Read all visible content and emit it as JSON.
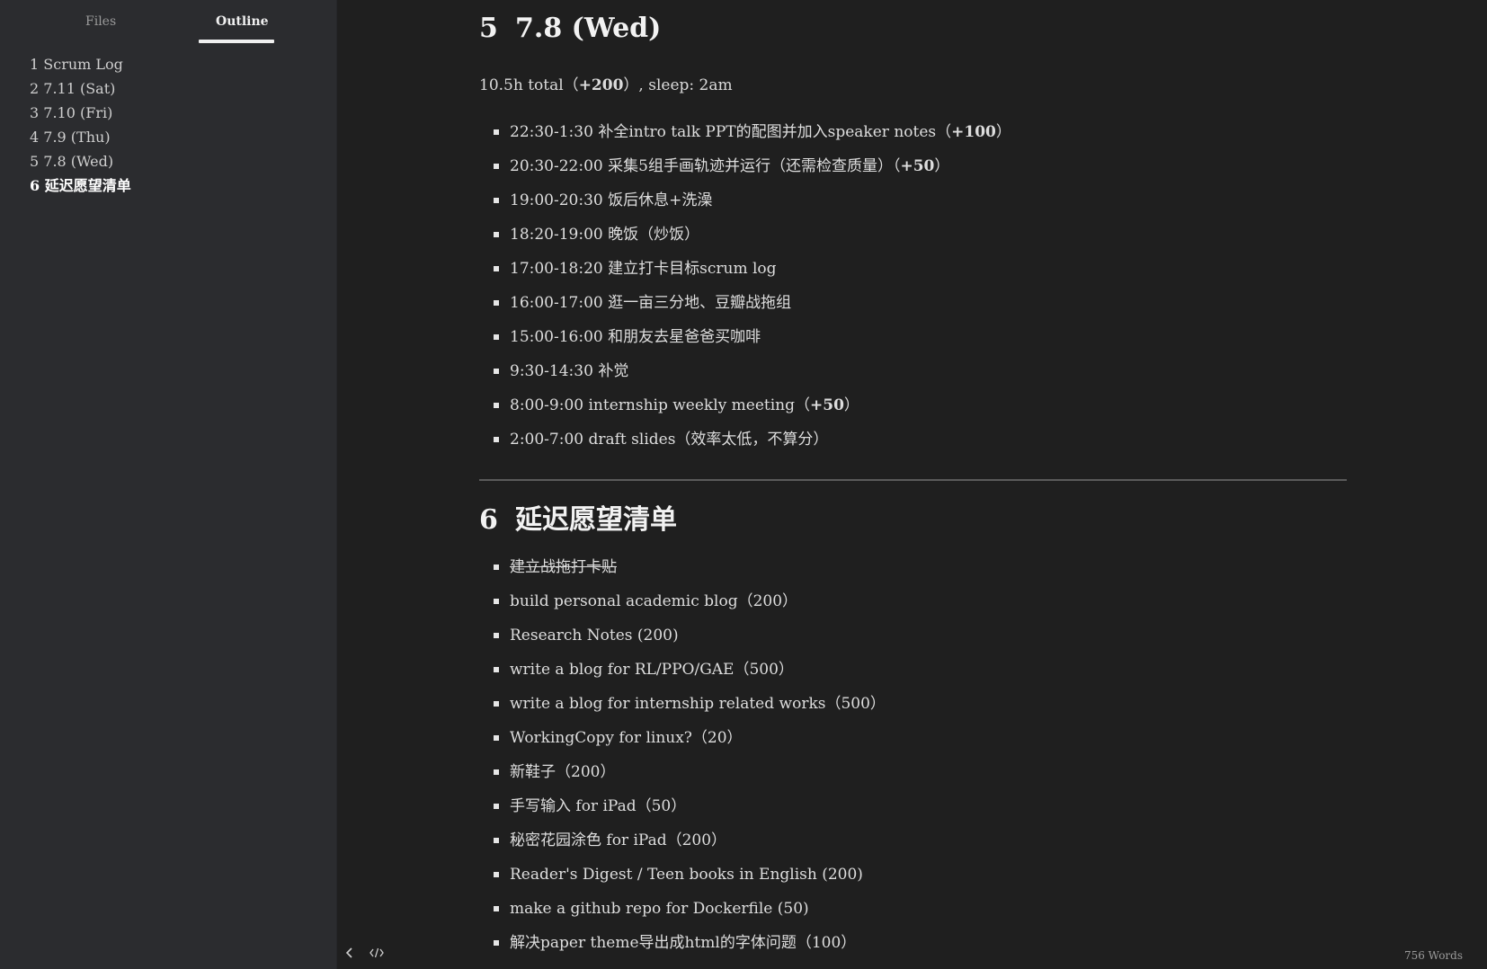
{
  "sidebar": {
    "tabs": {
      "files": "Files",
      "outline": "Outline"
    },
    "outline": [
      "1 Scrum Log",
      "2 7.11 (Sat)",
      "3 7.10 (Fri)",
      "4 7.9 (Thu)",
      "5 7.8 (Wed)",
      "6 延迟愿望清单"
    ]
  },
  "section5": {
    "num": "5",
    "title": "7.8 (Wed)",
    "summary_pre": "10.5h total（",
    "summary_bold": "+200",
    "summary_post": "）, sleep: 2am",
    "items": [
      {
        "pre": "22:30-1:30 补全intro talk PPT的配图并加入speaker notes（",
        "bold": "+100",
        "post": "）"
      },
      {
        "pre": "20:30-22:00 采集5组手画轨迹并运行（还需检查质量）（",
        "bold": "+50",
        "post": "）"
      },
      {
        "pre": "19:00-20:30 饭后休息+洗澡",
        "bold": "",
        "post": ""
      },
      {
        "pre": "18:20-19:00 晚饭（炒饭）",
        "bold": "",
        "post": ""
      },
      {
        "pre": "17:00-18:20 建立打卡目标scrum log",
        "bold": "",
        "post": ""
      },
      {
        "pre": "16:00-17:00 逛一亩三分地、豆瓣战拖组",
        "bold": "",
        "post": ""
      },
      {
        "pre": "15:00-16:00 和朋友去星爸爸买咖啡",
        "bold": "",
        "post": ""
      },
      {
        "pre": "9:30-14:30 补觉",
        "bold": "",
        "post": ""
      },
      {
        "pre": "8:00-9:00 internship weekly meeting（",
        "bold": "+50",
        "post": "）"
      },
      {
        "pre": "2:00-7:00 draft slides（效率太低，不算分）",
        "bold": "",
        "post": ""
      }
    ]
  },
  "section6": {
    "num": "6",
    "title": "延迟愿望清单",
    "items": [
      {
        "text": "建立战拖打卡贴",
        "struck": true
      },
      {
        "text": "build personal academic blog（200）",
        "struck": false
      },
      {
        "text": "Research Notes (200)",
        "struck": false
      },
      {
        "text": "write a blog for RL/PPO/GAE（500）",
        "struck": false
      },
      {
        "text": "write a blog for internship related works（500）",
        "struck": false
      },
      {
        "text": "WorkingCopy for linux?（20）",
        "struck": false
      },
      {
        "text": "新鞋子（200）",
        "struck": false
      },
      {
        "text": "手写输入 for iPad（50）",
        "struck": false
      },
      {
        "text": "秘密花园涂色 for iPad（200）",
        "struck": false
      },
      {
        "text": "Reader's Digest / Teen books in English (200)",
        "struck": false
      },
      {
        "text": "make a github repo for Dockerfile (50)",
        "struck": false
      },
      {
        "text": "解决paper theme导出成html的字体问题（100）",
        "struck": false
      }
    ]
  },
  "footer": {
    "back_icon": "chevron-left-icon",
    "source_icon": "code-icon",
    "word_count": "756 Words"
  }
}
